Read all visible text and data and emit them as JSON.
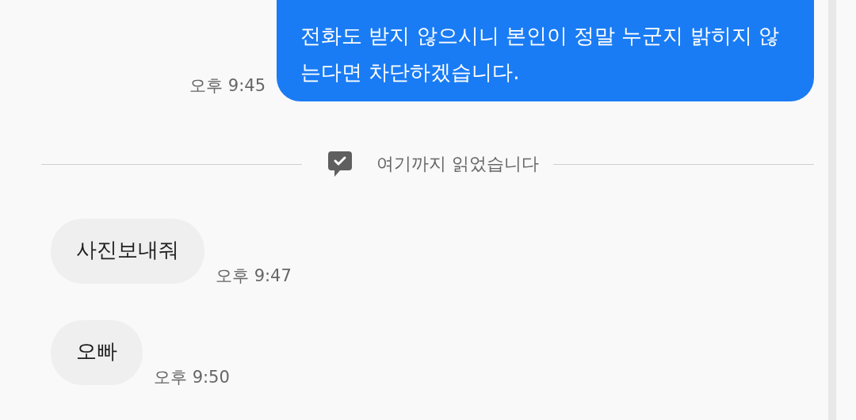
{
  "messages": [
    {
      "kind": "sent",
      "text": "전화도 받지 않으시니 본인이 정말 누군지 밝히지 않는다면 차단하겠습니다.",
      "time": "오후 9:45"
    },
    {
      "kind": "read_marker",
      "text": "여기까지 읽었습니다"
    },
    {
      "kind": "received",
      "text": "사진보내줘",
      "time": "오후 9:47"
    },
    {
      "kind": "received",
      "text": "오빠",
      "time": "오후 9:50"
    }
  ]
}
